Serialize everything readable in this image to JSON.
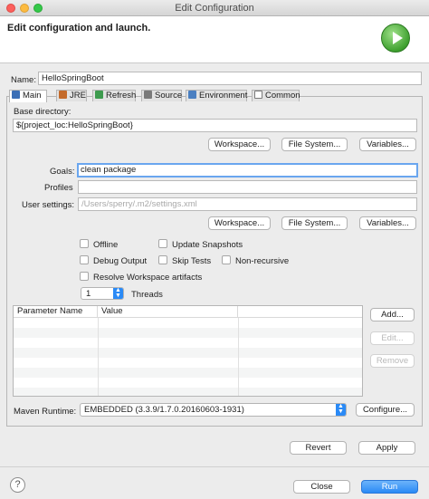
{
  "window": {
    "title": "Edit Configuration"
  },
  "header": {
    "text": "Edit configuration and launch.",
    "icon": "run-launch-icon"
  },
  "name": {
    "label": "Name:",
    "value": "HelloSpringBoot"
  },
  "tabs": [
    {
      "label": "Main",
      "icon": "maven-m2-icon",
      "active": true
    },
    {
      "label": "JRE",
      "icon": "jre-icon"
    },
    {
      "label": "Refresh",
      "icon": "refresh-icon"
    },
    {
      "label": "Source",
      "icon": "source-icon"
    },
    {
      "label": "Environment",
      "icon": "environment-icon"
    },
    {
      "label": "Common",
      "icon": "common-icon"
    }
  ],
  "main": {
    "base_dir_label": "Base directory:",
    "base_dir_value": "${project_loc:HelloSpringBoot}",
    "workspace_btn": "Workspace...",
    "filesystem_btn": "File System...",
    "variables_btn": "Variables...",
    "goals_label": "Goals:",
    "goals_value": "clean package",
    "profiles_label": "Profiles",
    "profiles_value": "",
    "user_settings_label": "User settings:",
    "user_settings_placeholder": "/Users/sperry/.m2/settings.xml",
    "checkboxes": {
      "offline": "Offline",
      "update_snapshots": "Update Snapshots",
      "debug_output": "Debug Output",
      "skip_tests": "Skip Tests",
      "non_recursive": "Non-recursive",
      "resolve_workspace": "Resolve Workspace artifacts"
    },
    "threads_value": "1",
    "threads_label": "Threads",
    "table": {
      "col_name": "Parameter Name",
      "col_value": "Value"
    },
    "add_btn": "Add...",
    "edit_btn": "Edit...",
    "remove_btn": "Remove",
    "runtime_label": "Maven Runtime:",
    "runtime_value": "EMBEDDED (3.3.9/1.7.0.20160603-1931)",
    "configure_btn": "Configure..."
  },
  "footer": {
    "revert_btn": "Revert",
    "apply_btn": "Apply",
    "close_btn": "Close",
    "run_btn": "Run",
    "help": "?"
  },
  "colors": {
    "accent": "#2a8af6",
    "run_green": "#3fa12f"
  }
}
